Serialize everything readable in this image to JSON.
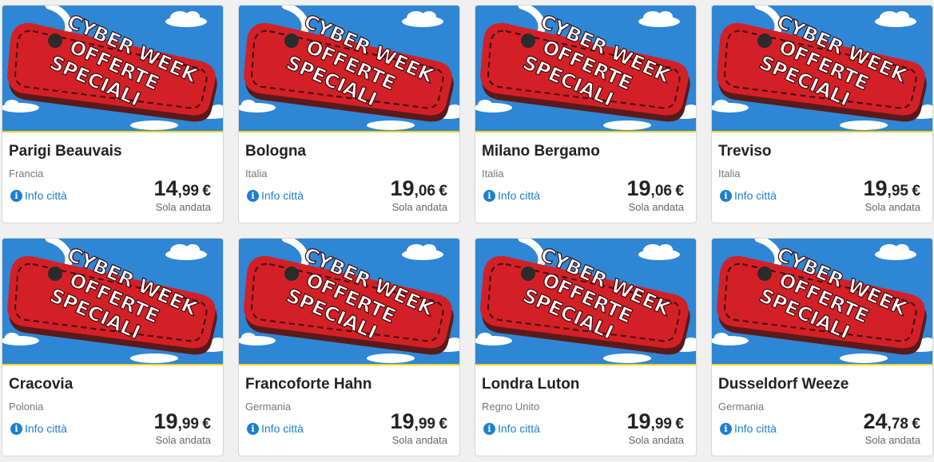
{
  "banner": {
    "line1": "CYBER WEEK",
    "line2": "OFFERTE",
    "line3": "SPECIALI"
  },
  "colors": {
    "sky": "#2e86d4",
    "tag": "#d32027",
    "accent": "#1c7fd0",
    "stripe": "#f2d21f"
  },
  "info_label": "Info città",
  "trip_label": "Sola andata",
  "currency": "€",
  "cards": [
    {
      "city": "Parigi Beauvais",
      "country": "Francia",
      "price_int": "14",
      "price_dec": ",99"
    },
    {
      "city": "Bologna",
      "country": "Italia",
      "price_int": "19",
      "price_dec": ",06"
    },
    {
      "city": "Milano Bergamo",
      "country": "Italia",
      "price_int": "19",
      "price_dec": ",06"
    },
    {
      "city": "Treviso",
      "country": "Italia",
      "price_int": "19",
      "price_dec": ",95"
    },
    {
      "city": "Cracovia",
      "country": "Polonia",
      "price_int": "19",
      "price_dec": ",99"
    },
    {
      "city": "Francoforte Hahn",
      "country": "Germania",
      "price_int": "19",
      "price_dec": ",99"
    },
    {
      "city": "Londra Luton",
      "country": "Regno Unito",
      "price_int": "19",
      "price_dec": ",99"
    },
    {
      "city": "Dusseldorf Weeze",
      "country": "Germania",
      "price_int": "24",
      "price_dec": ",78"
    }
  ]
}
